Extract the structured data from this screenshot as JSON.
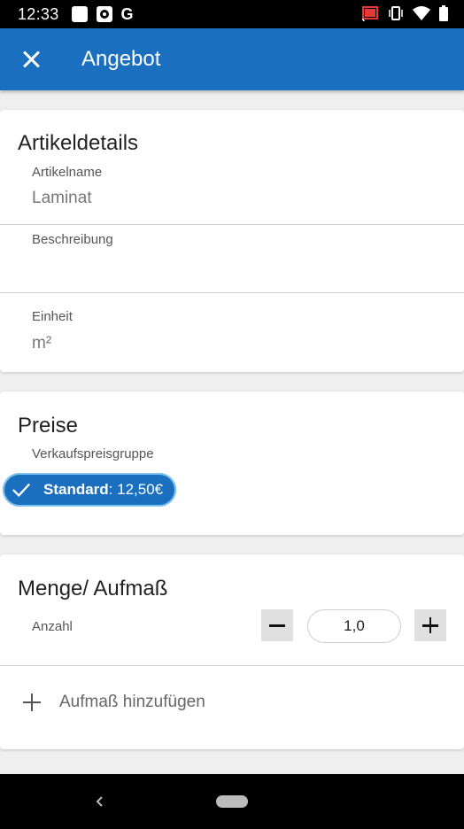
{
  "status_bar": {
    "time": "12:33",
    "g_label": "G"
  },
  "app_bar": {
    "title": "Angebot"
  },
  "article_card": {
    "heading": "Artikeldetails",
    "name_label": "Artikelname",
    "name_value": "Laminat",
    "description_label": "Beschreibung",
    "description_value": "",
    "unit_label": "Einheit",
    "unit_value": "m²"
  },
  "prices_card": {
    "heading": "Preise",
    "group_label": "Verkaufspreisgruppe",
    "chip_name": "Standard",
    "chip_value": ": 12,50€"
  },
  "quantity_card": {
    "heading": "Menge/ Aufmaß",
    "count_label": "Anzahl",
    "count_value": "1,0",
    "add_measurement_label": "Aufmaß hinzufügen"
  },
  "colors": {
    "primary": "#1a6fbf",
    "background": "#efefef"
  }
}
